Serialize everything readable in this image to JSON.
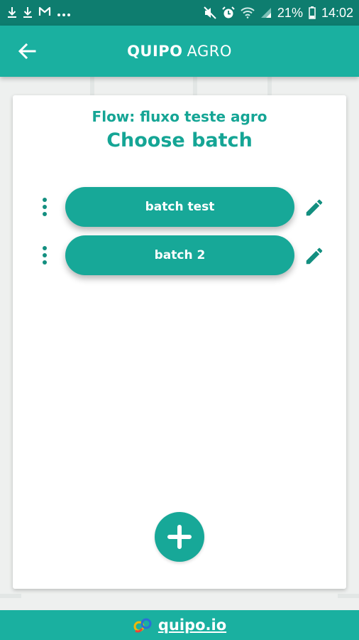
{
  "status_bar": {
    "battery": "21%",
    "time": "14:02",
    "left_icons": [
      "download-icon",
      "download-icon",
      "gmail-icon",
      "more-dots-icon"
    ],
    "right_icons": [
      "mute-icon",
      "alarm-icon",
      "wifi-icon",
      "signal-icon",
      "battery-icon"
    ]
  },
  "app_bar": {
    "brand_bold": "QUIPO",
    "brand_light": "AGRO",
    "back_icon": "arrow-left-icon"
  },
  "content": {
    "flow_label": "Flow: fluxo teste agro",
    "title": "Choose batch"
  },
  "batches": [
    {
      "label": "batch test"
    },
    {
      "label": "batch 2"
    }
  ],
  "footer": {
    "link": "quipo.io",
    "logo_icon": "quipo-logo-icon"
  },
  "colors": {
    "status_bar": "#0e7d6f",
    "app_bar": "#1ab0a0",
    "accent": "#17a898",
    "accent_dark": "#138f80",
    "card": "#ffffff"
  }
}
